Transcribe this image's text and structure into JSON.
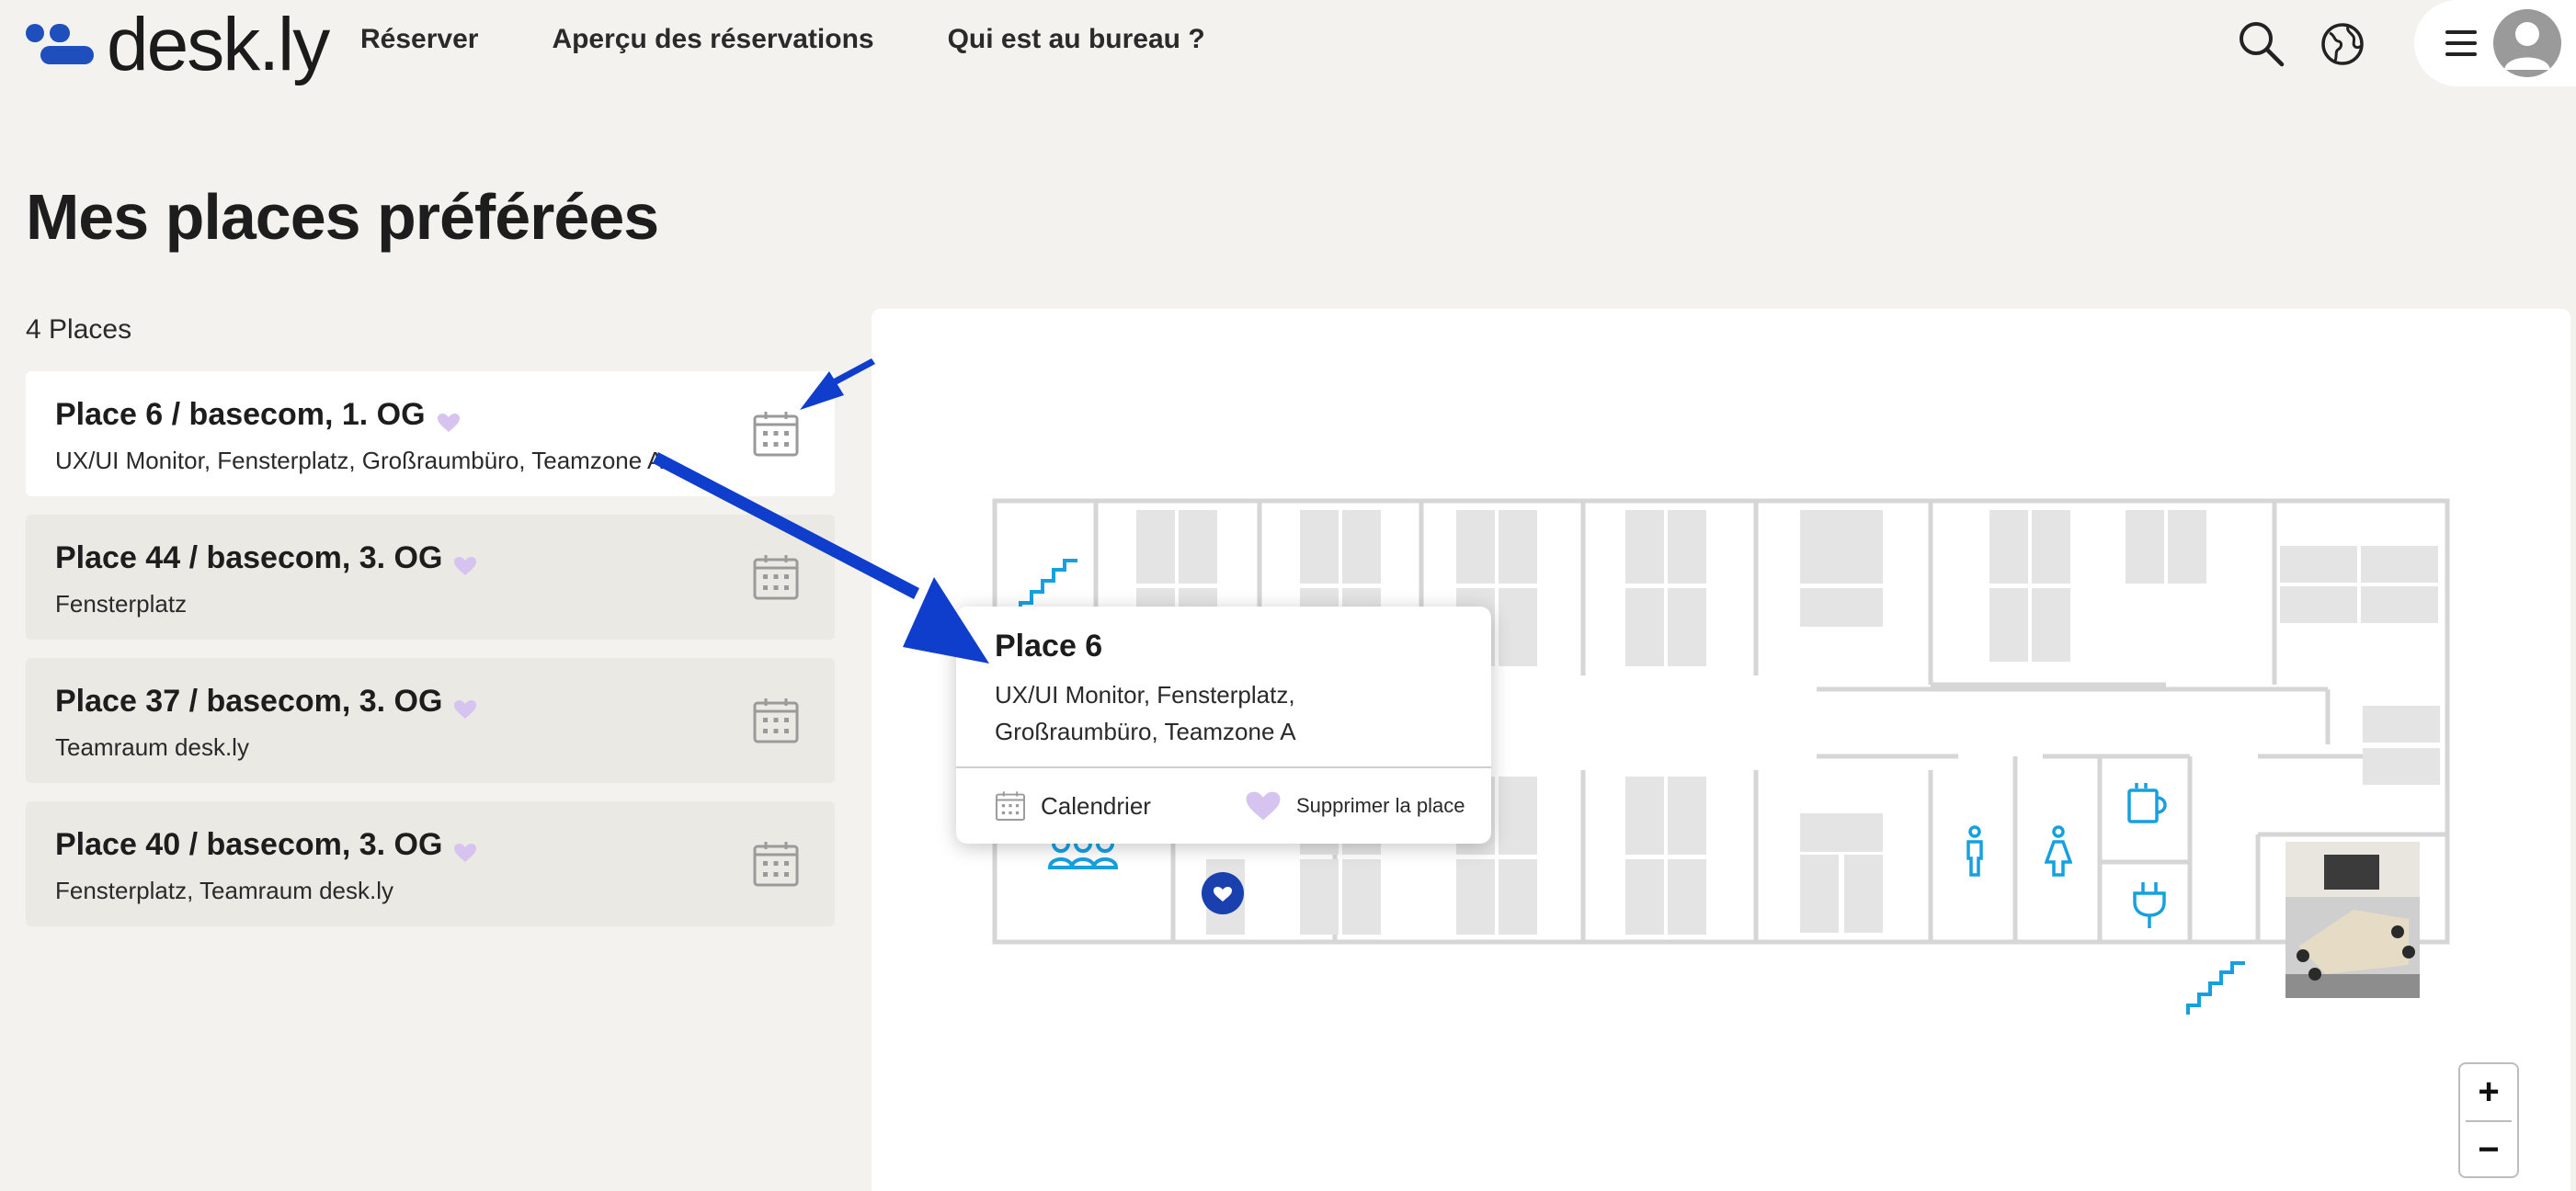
{
  "app": {
    "name": "desk.ly"
  },
  "nav": {
    "items": [
      {
        "label": "Réserver"
      },
      {
        "label": "Aperçu des réservations"
      },
      {
        "label": "Qui est au bureau ?"
      }
    ]
  },
  "page": {
    "title": "Mes places préférées",
    "count": "4 Places"
  },
  "places": [
    {
      "title": "Place 6 / basecom, 1. OG",
      "description": "UX/UI Monitor, Fensterplatz, Großraumbüro, Teamzone A"
    },
    {
      "title": "Place 44 / basecom, 3. OG",
      "description": "Fensterplatz"
    },
    {
      "title": "Place 37 / basecom, 3. OG",
      "description": "Teamraum desk.ly"
    },
    {
      "title": "Place 40 / basecom, 3. OG",
      "description": "Fensterplatz, Teamraum desk.ly"
    }
  ],
  "popup": {
    "title": "Place 6",
    "description": "UX/UI Monitor, Fensterplatz, Großraumbüro, Teamzone A",
    "calendar_label": "Calendrier",
    "remove_label": "Supprimer la place"
  },
  "zoom": {
    "in_label": "+",
    "out_label": "−"
  },
  "colors": {
    "brand_blue": "#1f4fbd",
    "heart_lilac": "#d7c3f0",
    "map_icon_blue": "#16a0e0",
    "seat_marker": "#1a3fae",
    "annotation_arrow": "#0f3dcc"
  },
  "icons": [
    "search-icon",
    "globe-icon",
    "hamburger-icon",
    "avatar-icon",
    "calendar-icon",
    "heart-icon",
    "stairs-icon",
    "person-icon",
    "coffee-icon",
    "plug-icon",
    "group-icon"
  ]
}
